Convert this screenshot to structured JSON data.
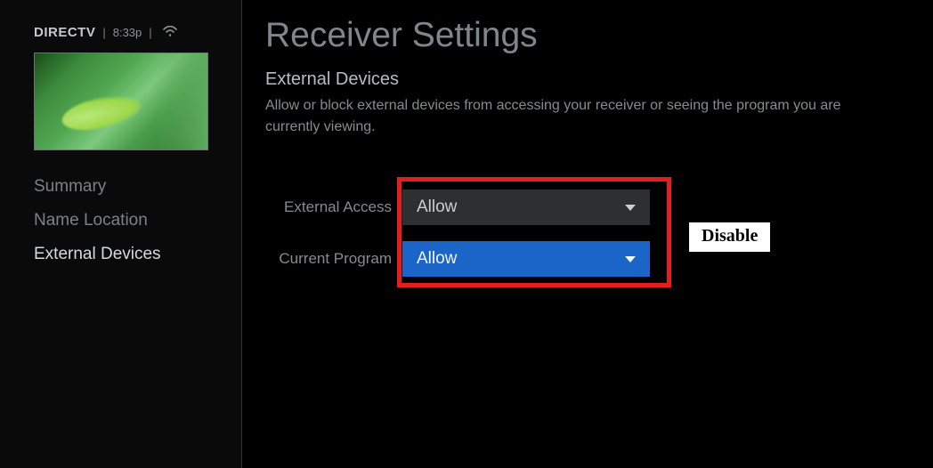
{
  "status": {
    "brand": "DIRECTV",
    "time": "8:33p",
    "wifi_glyph": "⩗"
  },
  "sidebar": {
    "items": [
      {
        "label": "Summary",
        "active": false
      },
      {
        "label": "Name Location",
        "active": false
      },
      {
        "label": "External Devices",
        "active": true
      }
    ]
  },
  "page": {
    "title": "Receiver Settings",
    "section_title": "External Devices",
    "section_desc": "Allow or block external devices from accessing your receiver or seeing the program you are currently viewing."
  },
  "settings": {
    "external_access": {
      "label": "External Access",
      "value": "Allow"
    },
    "current_program": {
      "label": "Current Program",
      "value": "Allow"
    }
  },
  "annotation": "Disable"
}
